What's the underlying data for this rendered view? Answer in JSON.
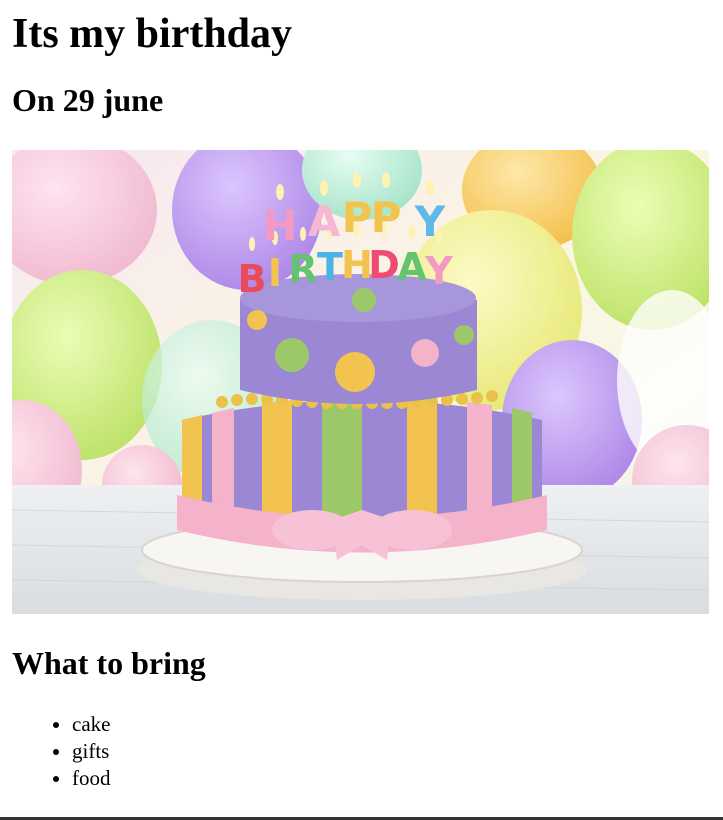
{
  "page": {
    "title": "Its my birthday",
    "date_heading": "On 29 june",
    "image": {
      "subject": "birthday-cake-photo",
      "candle_letters_row1": "HAPPY",
      "candle_letters_row2": "BIRTHDAY"
    },
    "bring_heading": "What to bring",
    "bring_items": [
      "cake",
      "gifts",
      "food"
    ]
  },
  "colors": {
    "cake_lavender": "#9b87d4",
    "cake_pink": "#f4b3cb",
    "cake_yellow": "#f2c44f",
    "cake_green": "#9dc86a",
    "bottom_bar": "#333333"
  }
}
